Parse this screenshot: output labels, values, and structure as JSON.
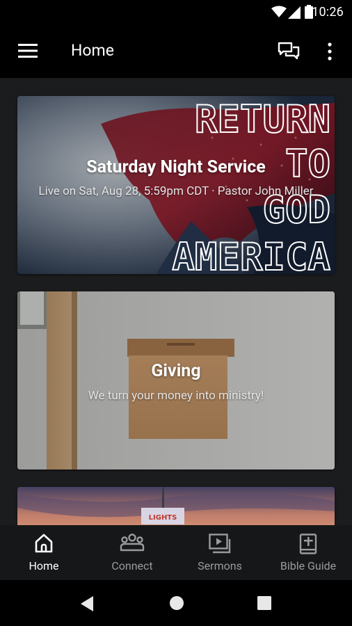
{
  "status_bar": {
    "time": "10:26"
  },
  "app_bar": {
    "title": "Home"
  },
  "cards": [
    {
      "title": "Saturday Night Service",
      "subtitle": "Live on Sat, Aug 28, 5:59pm CDT · Pastor John Miller",
      "artwork_text": [
        "RETURN",
        "TO",
        "GOD",
        "AMERICA"
      ]
    },
    {
      "title": "Giving",
      "subtitle": "We turn your money into ministry!"
    },
    {
      "sign_text": "LIGHTS"
    }
  ],
  "bottom_nav": [
    {
      "label": "Home",
      "icon": "home-icon",
      "active": true
    },
    {
      "label": "Connect",
      "icon": "people-icon",
      "active": false
    },
    {
      "label": "Sermons",
      "icon": "video-library-icon",
      "active": false
    },
    {
      "label": "Bible Guide",
      "icon": "book-plus-icon",
      "active": false
    }
  ],
  "colors": {
    "active": "#ffffff",
    "inactive": "#9a9b9d",
    "bar": "#000000",
    "background": "#1b1c1e"
  }
}
